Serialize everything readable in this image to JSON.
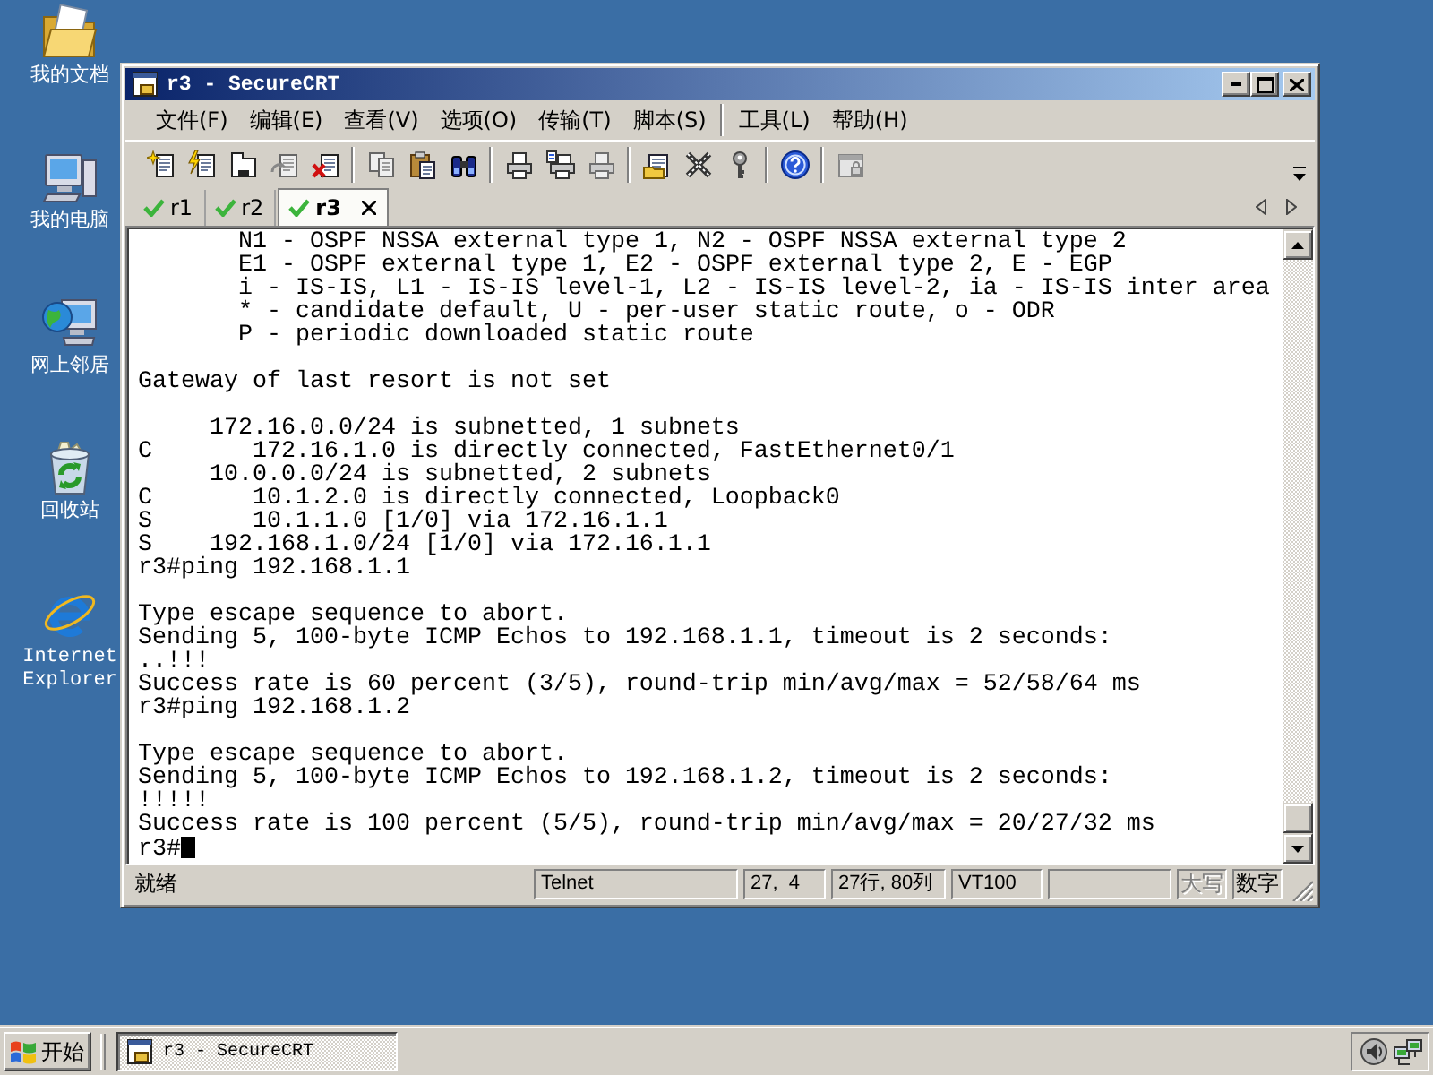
{
  "desktop_icons": [
    {
      "label": "我的文档",
      "kind": "documents"
    },
    {
      "label": "我的电脑",
      "kind": "computer"
    },
    {
      "label": "网上邻居",
      "kind": "network"
    },
    {
      "label": "回收站",
      "kind": "recycle"
    },
    {
      "label": "Internet Explorer",
      "kind": "browser"
    }
  ],
  "window": {
    "title": "r3 - SecureCRT"
  },
  "menu_groups": [
    [
      "文件(F)",
      "编辑(E)",
      "查看(V)",
      "选项(O)",
      "传输(T)",
      "脚本(S)"
    ],
    [
      "工具(L)",
      "帮助(H)"
    ]
  ],
  "toolbar": [
    [
      {
        "kind": "connect",
        "disabled": false
      },
      {
        "kind": "quickconnect",
        "disabled": false
      },
      {
        "kind": "tab",
        "disabled": false
      },
      {
        "kind": "reconnect",
        "disabled": true
      },
      {
        "kind": "disconnect",
        "disabled": false
      }
    ],
    [
      {
        "kind": "copy",
        "disabled": true
      },
      {
        "kind": "paste",
        "disabled": false
      },
      {
        "kind": "find",
        "disabled": false
      }
    ],
    [
      {
        "kind": "print",
        "disabled": false
      },
      {
        "kind": "printselection",
        "disabled": false
      },
      {
        "kind": "printsetup",
        "disabled": true
      }
    ],
    [
      {
        "kind": "session",
        "disabled": false
      },
      {
        "kind": "options",
        "disabled": false
      },
      {
        "kind": "key",
        "disabled": false
      }
    ],
    [
      {
        "kind": "help",
        "disabled": false
      }
    ],
    [
      {
        "kind": "lock",
        "disabled": true
      }
    ]
  ],
  "tabs": [
    {
      "label": "r1",
      "selected": false,
      "connected": true
    },
    {
      "label": "r2",
      "selected": false,
      "connected": true
    },
    {
      "label": "r3",
      "selected": true,
      "connected": true
    }
  ],
  "terminal": {
    "blocks": [
      [
        "       N1 - OSPF NSSA external type 1, N2 - OSPF NSSA external type 2",
        "       E1 - OSPF external type 1, E2 - OSPF external type 2, E - EGP",
        "       i - IS-IS, L1 - IS-IS level-1, L2 - IS-IS level-2, ia - IS-IS inter area",
        "       * - candidate default, U - per-user static route, o - ODR",
        "       P - periodic downloaded static route"
      ],
      [
        "Gateway of last resort is not set"
      ],
      [
        "     172.16.0.0/24 is subnetted, 1 subnets",
        "C       172.16.1.0 is directly connected, FastEthernet0/1",
        "     10.0.0.0/24 is subnetted, 2 subnets",
        "C       10.1.2.0 is directly connected, Loopback0",
        "S       10.1.1.0 [1/0] via 172.16.1.1",
        "S    192.168.1.0/24 [1/0] via 172.16.1.1",
        "r3#ping 192.168.1.1"
      ],
      [
        "Type escape sequence to abort.",
        "Sending 5, 100-byte ICMP Echos to 192.168.1.1, timeout is 2 seconds:",
        "..!!!",
        "Success rate is 60 percent (3/5), round-trip min/avg/max = 52/58/64 ms",
        "r3#ping 192.168.1.2"
      ],
      [
        "Type escape sequence to abort.",
        "Sending 5, 100-byte ICMP Echos to 192.168.1.2, timeout is 2 seconds:",
        "!!!!!",
        "Success rate is 100 percent (5/5), round-trip min/avg/max = 20/27/32 ms",
        "r3#"
      ]
    ],
    "cursor": true
  },
  "status_bar": {
    "message": "就绪",
    "protocol": "Telnet",
    "position": "27,  4",
    "size": "27行, 80列",
    "emulation": "VT100",
    "indicators": [
      {
        "label": "大写",
        "on": false
      },
      {
        "label": "数字",
        "on": true
      }
    ]
  },
  "taskbar": {
    "start": "开始",
    "tasks": [
      {
        "label": "r3 - SecureCRT",
        "selected": true
      }
    ]
  }
}
